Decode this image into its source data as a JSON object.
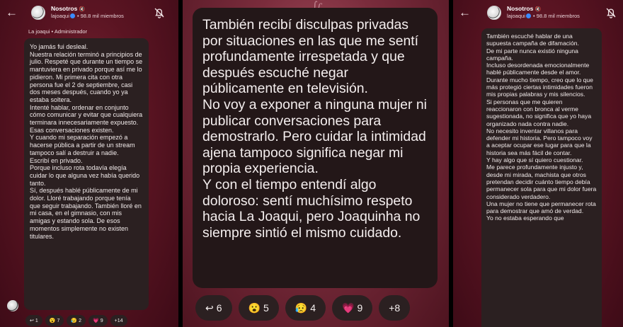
{
  "channel": {
    "name": "Nosotros",
    "handle": "lajoaqui",
    "members": "98.8 mil miembros"
  },
  "left": {
    "author": "La joaqui • Administrador",
    "message": "Yo jamás fui desleal.\nNuestra relación terminó a principios de julio. Respeté que durante un tiempo se mantuviera en privado porque así me lo pidieron. Mi primera cita con otra persona fue el 2 de septiembre, casi dos meses después, cuando yo ya estaba soltera.\nIntenté hablar, ordenar en conjunto cómo comunicar y evitar que cualquiera terminara innecesariamente expuesto. Esas conversaciones existen.\nY cuando mi separación empezó a hacerse pública a partir de un stream tampoco salí a destruir a nadie.\nEscribí en privado.\nPorque incluso rota todavía elegía cuidar lo que alguna vez había querido tanto.\nSí, después hablé públicamente de mi dolor. Lloré trabajando porque tenía que seguir trabajando. También lloré en mi casa, en el gimnasio, con mis amigas y estando sola. De esos momentos simplemente no existen titulares.",
    "reactions": [
      {
        "icon": "reply-arrow-icon",
        "emoji": "↩",
        "count": "1"
      },
      {
        "icon": "surprised-emoji",
        "emoji": "😮",
        "count": "7"
      },
      {
        "icon": "sad-emoji",
        "emoji": "😥",
        "count": "2"
      },
      {
        "icon": "heart-emoji",
        "emoji": "💗",
        "count": "9"
      },
      {
        "icon": "more-reactions",
        "emoji": "",
        "count": "+14"
      }
    ]
  },
  "middle": {
    "message": "También recibí disculpas privadas por situaciones en las que me sentí profundamente irrespetada y que después escuché negar públicamente en televisión.\nNo voy a exponer a ninguna mujer ni publicar conversaciones para demostrarlo. Pero cuidar la intimidad ajena tampoco significa negar mi propia experiencia.\nY con el tiempo entendí algo doloroso: sentí muchísimo respeto hacia La Joaqui, pero Joaquinha no siempre sintió el mismo cuidado.",
    "reactions": [
      {
        "icon": "reply-arrow-icon",
        "emoji": "↩",
        "count": "6"
      },
      {
        "icon": "surprised-emoji",
        "emoji": "😮",
        "count": "5"
      },
      {
        "icon": "sad-emoji",
        "emoji": "😥",
        "count": "4"
      },
      {
        "icon": "heart-emoji",
        "emoji": "💗",
        "count": "9"
      },
      {
        "icon": "more-reactions",
        "emoji": "",
        "count": "+8"
      }
    ]
  },
  "right": {
    "message": "También escuché hablar de una supuesta campaña de difamación.\nDe mi parte nunca existió ninguna campaña.\nIncluso desordenada emocionalmente hablé públicamente desde el amor.\nDurante mucho tiempo, creo que lo que más protegió ciertas intimidades fueron mis propias palabras y mis silencios.\nSi personas que me quieren reaccionaron con bronca al verme sugestionada, no significa que yo haya organizado nada contra nadie.\nNo necesito inventar villanos para defender mi historia. Pero tampoco voy a aceptar ocupar ese lugar para que la historia sea más fácil de contar.\nY hay algo que sí quiero cuestionar.\nMe parece profundamente injusto y, desde mi mirada, machista que otros pretendan decidir cuánto tiempo debía permanecer sola para que mi dolor fuera considerado verdadero.\nUna mujer no tiene que permanecer rota para demostrar que amó de verdad.\nYo no estaba esperando que"
  }
}
